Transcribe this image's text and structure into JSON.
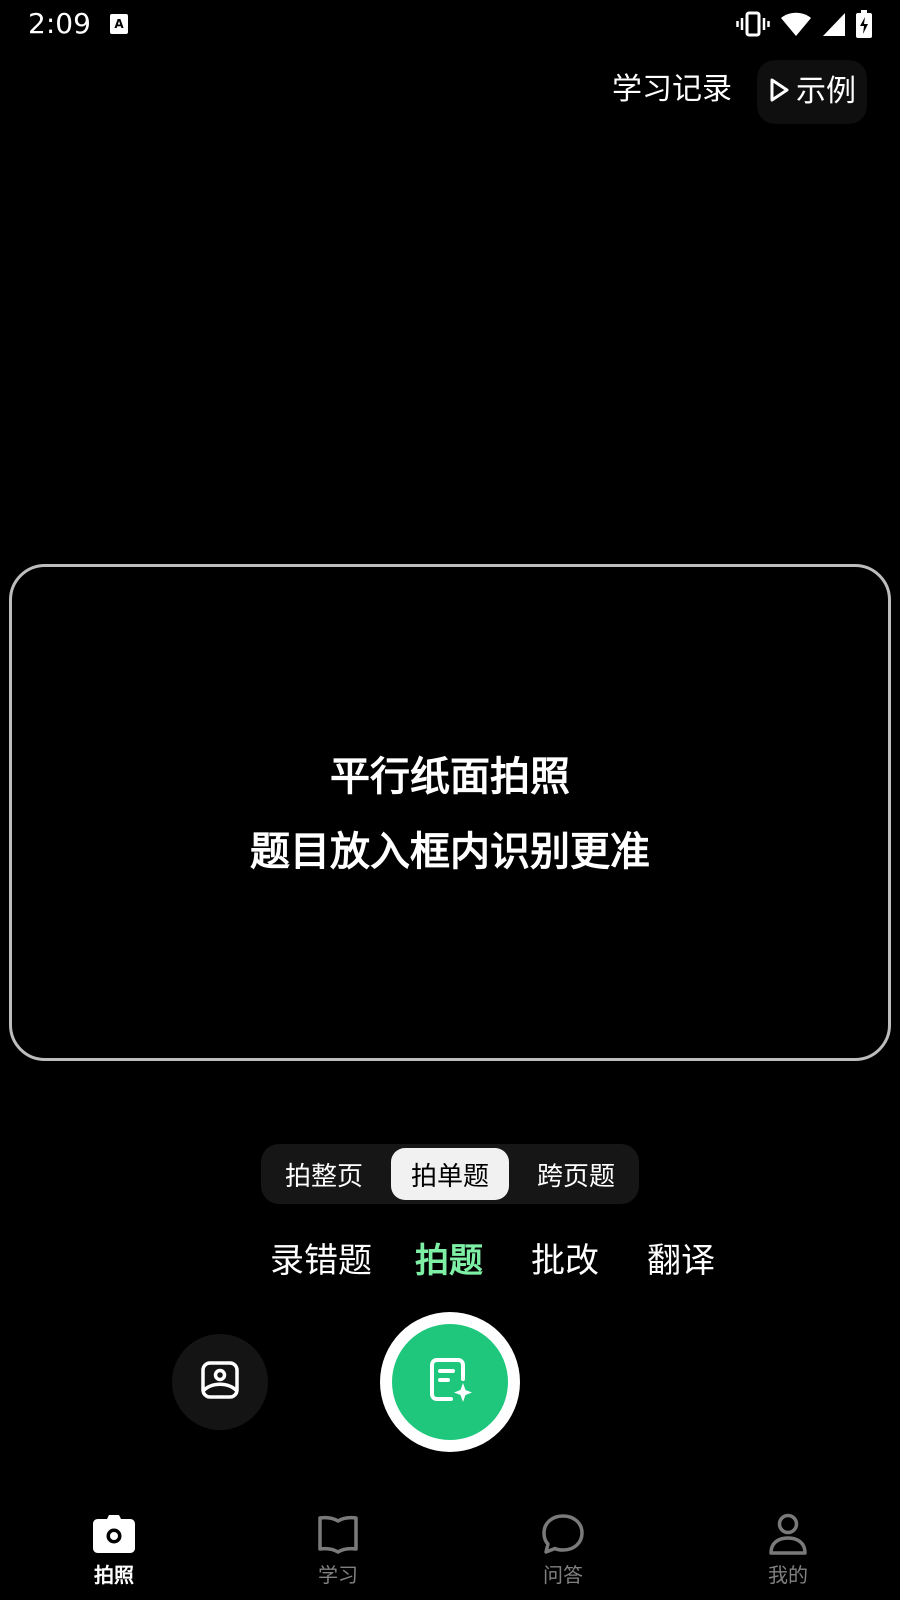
{
  "status_bar": {
    "time": "2:09",
    "icons": [
      "app-notification-icon",
      "vibrate-icon",
      "wifi-icon",
      "signal-icon",
      "battery-charging-icon"
    ]
  },
  "top_actions": {
    "history_label": "学习记录",
    "example_label": "示例",
    "example_icon": "play-icon"
  },
  "camera": {
    "hint_line1": "平行纸面拍照",
    "hint_line2": "题目放入框内识别更准",
    "frame_color": "#bdbdbd"
  },
  "capture_scope": {
    "options": [
      {
        "label": "拍整页",
        "selected": false
      },
      {
        "label": "拍单题",
        "selected": true
      },
      {
        "label": "跨页题",
        "selected": false
      }
    ]
  },
  "modes": {
    "items": [
      {
        "label": "录错题",
        "active": false
      },
      {
        "label": "拍题",
        "active": true
      },
      {
        "label": "批改",
        "active": false
      },
      {
        "label": "翻译",
        "active": false
      }
    ],
    "active_color": "#7ef0a6"
  },
  "controls": {
    "gallery_icon": "image-gallery-icon",
    "shutter_icon": "document-sparkle-icon",
    "shutter_color": "#1fc77d"
  },
  "bottom_nav": {
    "items": [
      {
        "label": "拍照",
        "icon": "camera-icon",
        "active": true
      },
      {
        "label": "学习",
        "icon": "book-icon",
        "active": false
      },
      {
        "label": "问答",
        "icon": "chat-bubble-icon",
        "active": false
      },
      {
        "label": "我的",
        "icon": "person-icon",
        "active": false
      }
    ]
  }
}
